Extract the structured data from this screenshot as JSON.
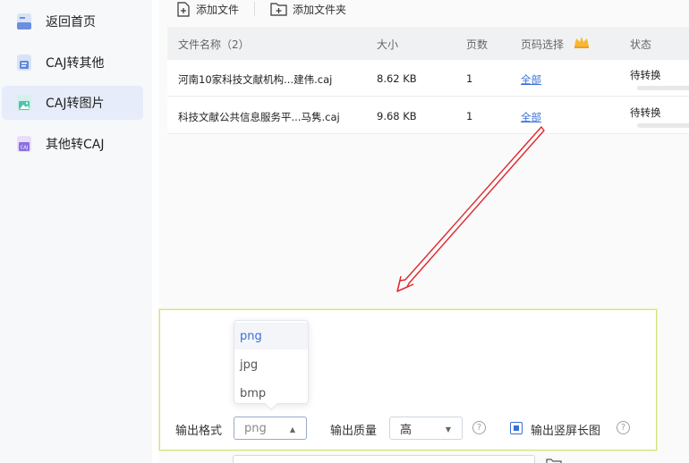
{
  "sidebar": {
    "items": [
      {
        "label": "返回首页",
        "icon": "home-icon"
      },
      {
        "label": "CAJ转其他",
        "icon": "document-icon"
      },
      {
        "label": "CAJ转图片",
        "icon": "image-icon",
        "active": true
      },
      {
        "label": "其他转CAJ",
        "icon": "caj-icon"
      }
    ]
  },
  "toolbar": {
    "add_file": "添加文件",
    "add_folder": "添加文件夹"
  },
  "table": {
    "headers": {
      "name": "文件名称（2）",
      "size": "大小",
      "pages": "页数",
      "page_select": "页码选择",
      "status": "状态"
    },
    "rows": [
      {
        "name": "河南10家科技文献机构...建伟.caj",
        "size": "8.62 KB",
        "pages": "1",
        "page_select": "全部",
        "status": "待转换"
      },
      {
        "name": "科技文献公共信息服务平...马隽.caj",
        "size": "9.68 KB",
        "pages": "1",
        "page_select": "全部",
        "status": "待转换"
      }
    ]
  },
  "settings": {
    "format_label": "输出格式",
    "format_value": "png",
    "format_options": [
      "png",
      "jpg",
      "bmp"
    ],
    "quality_label": "输出质量",
    "quality_value": "高",
    "long_image_label": "输出竖屏长图",
    "help_glyph": "?"
  },
  "colors": {
    "accent": "#3a6fd8",
    "annotation_arrow": "#e0262b",
    "panel_border": "#d4e27a",
    "sidebar_active": "#e6ecf9"
  }
}
